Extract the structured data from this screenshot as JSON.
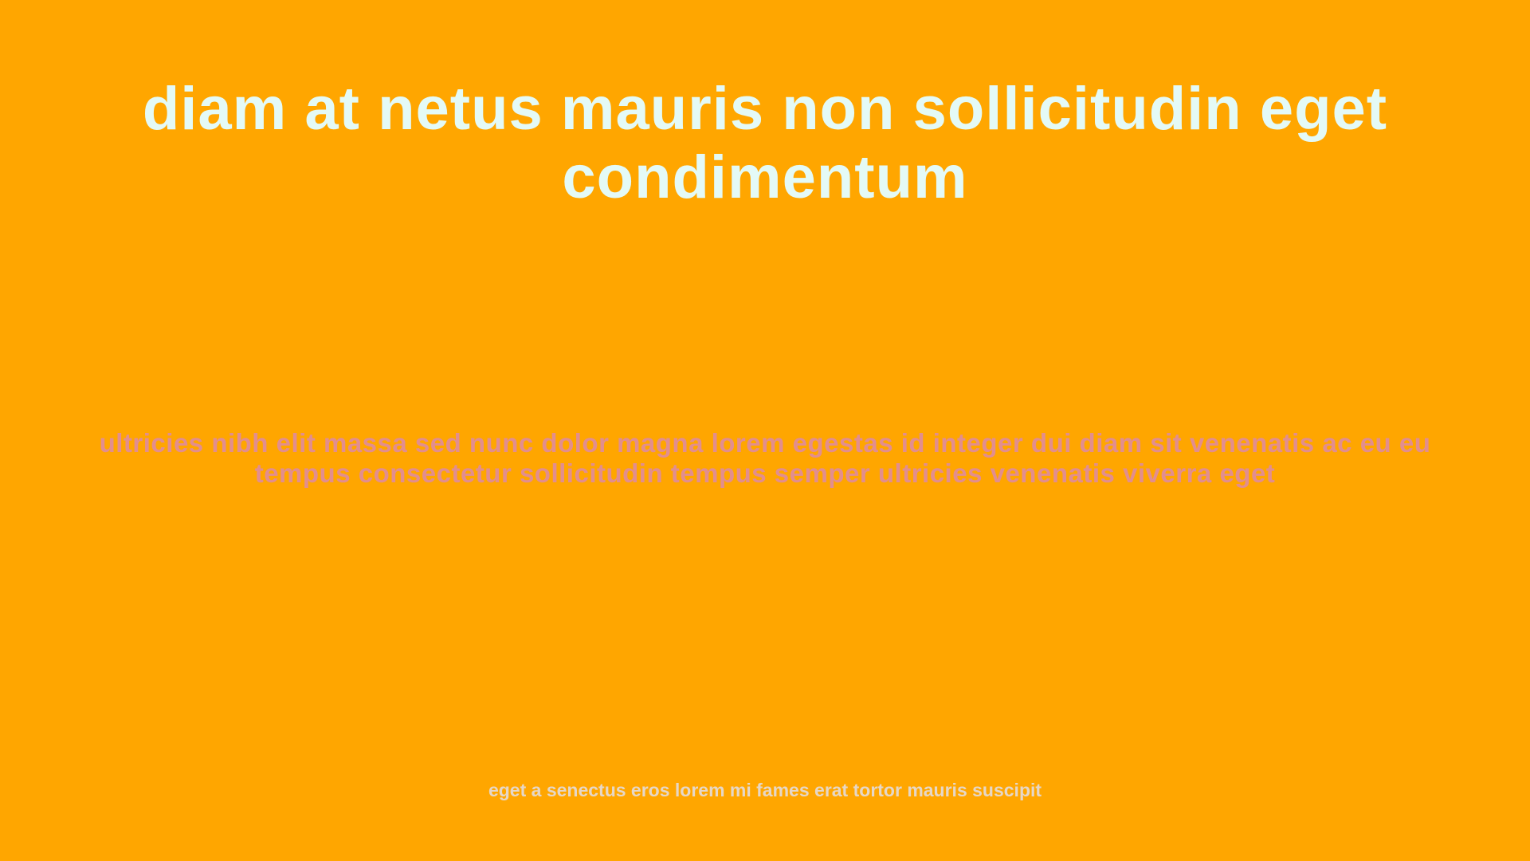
{
  "slide": {
    "title": "diam at netus mauris non sollicitudin eget condimentum",
    "subtitle": "ultricies nibh elit massa sed nunc dolor magna lorem egestas id integer dui diam sit venenatis ac eu eu tempus consectetur sollicitudin tempus semper ultricies venenatis viverra eget",
    "footer": "eget a senectus eros lorem mi fames erat tortor mauris suscipit"
  },
  "colors": {
    "background": "#FFA600",
    "title": "#E4FAF6",
    "subtitle": "#E28E8E",
    "footer": "#E6D7C7"
  }
}
